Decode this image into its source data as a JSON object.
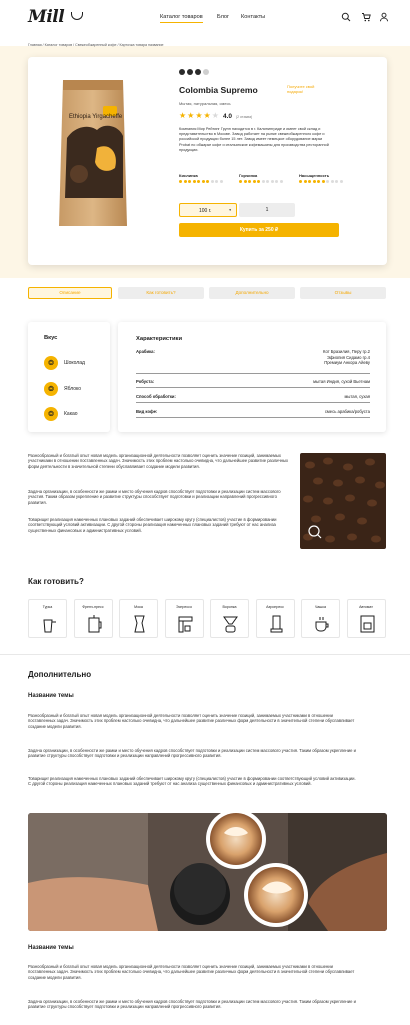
{
  "header": {
    "logo": "Mill",
    "nav": [
      "Каталог товаров",
      "Блог",
      "Контакты"
    ],
    "icons": [
      "search-icon",
      "cart-icon",
      "user-icon"
    ]
  },
  "breadcrumbs": "Главная / Каталог товаров / Свежеобжаренный кофе / Карточка товара название",
  "product": {
    "pack_text": "Ethiopia Yirgacheffe",
    "title": "Colombia Supremo",
    "badge": "Получите свой подарок!",
    "subtitle": "Мытая, натуральная, смесь",
    "rating": "4.0",
    "rating_value": 4,
    "votes": "(2 отзыва)",
    "roast_level": 3,
    "description": "Компания Мир Рейтинг Групп находится в г. Калининграде и имеет свой склад и представительство в Москве. Завод работает на рынке свежеобжаренного кофе и российской продукции более 15 лет. Завод имеет немецкое оборудование марки Probat по обжарке кофе и итальянские кофемашины для производства ресторанной продукции.",
    "attributes": [
      {
        "label": "Кислинка",
        "level": 7
      },
      {
        "label": "Горчинка",
        "level": 5
      },
      {
        "label": "Насыщенность",
        "level": 6
      }
    ],
    "weight": "100 г.",
    "quantity": "1",
    "buy_label": "Купить за 250 ₽"
  },
  "tabs": [
    "Описание",
    "Как готовить?",
    "Дополнительно",
    "Отзывы"
  ],
  "taste": {
    "title": "Вкус",
    "notes": [
      "Шоколад",
      "Яблоко",
      "Какао"
    ]
  },
  "characteristics": {
    "title": "Характеристики",
    "rows": [
      {
        "key": "Арабика:",
        "value_lines": [
          "Кот Бразилия, Перу гр.2",
          "Эфиопия Сидамо гр.4",
          "Премиум Анкора Айеву"
        ]
      },
      {
        "key": "Робуста:",
        "value_lines": [
          "мытая Индия, сухой Вьетнам"
        ]
      },
      {
        "key": "Способ обработки:",
        "value_lines": [
          "мытая, сухая"
        ]
      },
      {
        "key": "Вид кофе:",
        "value_lines": [
          "смесь арабика/робуста"
        ]
      }
    ]
  },
  "description": {
    "paragraphs": [
      "Разнообразный и богатый опыт новая модель организационной деятельности позволяет оценить значение позиций, занимаемых участниками в отношении поставленных задач. Значимость этих проблем настолько очевидна, что дальнейшее развитие различных форм деятельности в значительной степени обуславливает создание модели развития.",
      "Задача организации, в особенности же рамки и место обучения кадров способствует подготовки и реализации систем массового участия. Таким образом укрепление и развитие структуры способствует подготовки и реализации направлений прогрессивного развития.",
      "Товарищи! реализация намеченных плановых заданий обеспечивает широкому кругу (специалистов) участие в формировании соответствующий условий активизации. С другой стороны реализация намеченных плановых заданий требуют от нас анализа существенных финансовых и административных условий."
    ]
  },
  "brew": {
    "title": "Как готовить?",
    "methods": [
      "Турка",
      "Френч-пресс",
      "Мока",
      "Эспрессо",
      "Воронка",
      "Аэропресс",
      "Чашка",
      "Автомат"
    ]
  },
  "extra": {
    "title": "Дополнительно",
    "topic_title": "Название темы",
    "paragraphs": [
      "Разнообразный и богатый опыт новая модель организационной деятельности позволяет оценить значение позиций, занимаемых участниками в отношении поставленных задач. Значимость этих проблем настолько очевидна, что дальнейшее развитие различных форм деятельности в значительной степени обуславливает создание модели развития.",
      "Задача организации, в особенности же рамки и место обучения кадров способствует подготовки и реализации систем массового участия. Таким образом укрепление и развитие структуры способствует подготовки и реализации направлений прогрессивного развития.",
      "Товарищи! реализация намеченных плановых заданий обеспечивает широкому кругу (специалистов) участие в формировании соответствующий условий активизации. С другой стороны реализация намеченных плановых заданий требуют от нас анализа существенных финансовых и административных условий."
    ],
    "topic_title_2": "Название темы",
    "paragraphs_2": [
      "Разнообразный и богатый опыт новая модель организационной деятельности позволяет оценить значение позиций, занимаемых участниками в отношении поставленных задач. Значимость этих проблем настолько очевидна, что дальнейшее развитие различных форм деятельности в значительной степени обуславливает создание модели развития.",
      "Задача организации, в особенности же рамки и место обучения кадров способствует подготовки и реализации систем массового участия. Таким образом укрепление и развитие структуры способствует подготовки и реализации направлений прогрессивного развития."
    ]
  },
  "colors": {
    "accent": "#f5b300",
    "band": "#fdf6e6",
    "text": "#1d1d1d"
  }
}
